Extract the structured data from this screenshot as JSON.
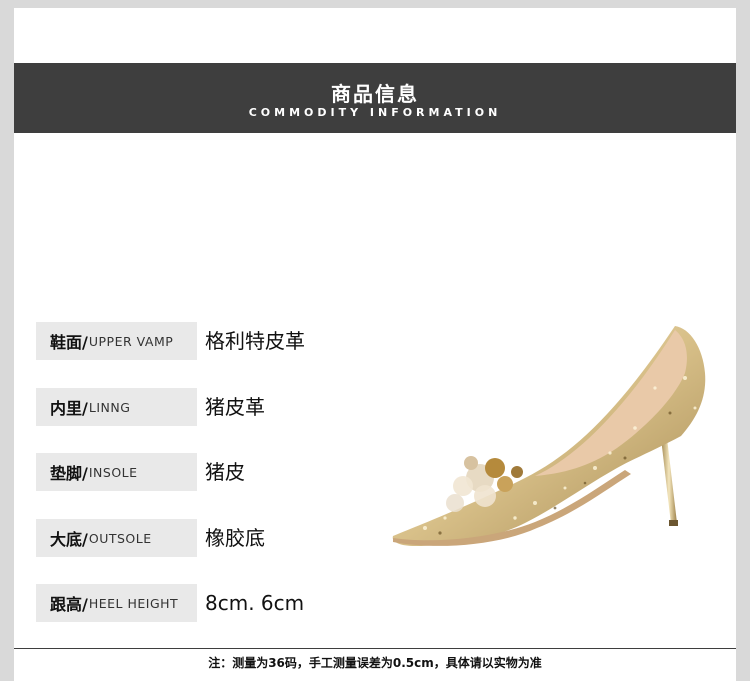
{
  "header": {
    "title_cn": "商品信息",
    "title_en": "COMMODITY INFORMATION"
  },
  "specs": [
    {
      "label_cn": "鞋面/",
      "label_en": "UPPER VAMP",
      "value": "格利特皮革"
    },
    {
      "label_cn": "内里/",
      "label_en": "LINNG",
      "value": "猪皮革"
    },
    {
      "label_cn": "垫脚/",
      "label_en": "INSOLE",
      "value": "猪皮"
    },
    {
      "label_cn": "大底/",
      "label_en": "OUTSOLE",
      "value": "橡胶底"
    },
    {
      "label_cn": "跟高/",
      "label_en": "HEEL HEIGHT",
      "value": "8cm. 6cm"
    }
  ],
  "footer": {
    "note": "注：测量为36码，手工测量误差为0.5cm，具体请以实物为准"
  },
  "colors": {
    "header_bg": "#3e3e3e",
    "label_bg": "#e9e9e9",
    "shoe_gold": "#d8c089"
  }
}
